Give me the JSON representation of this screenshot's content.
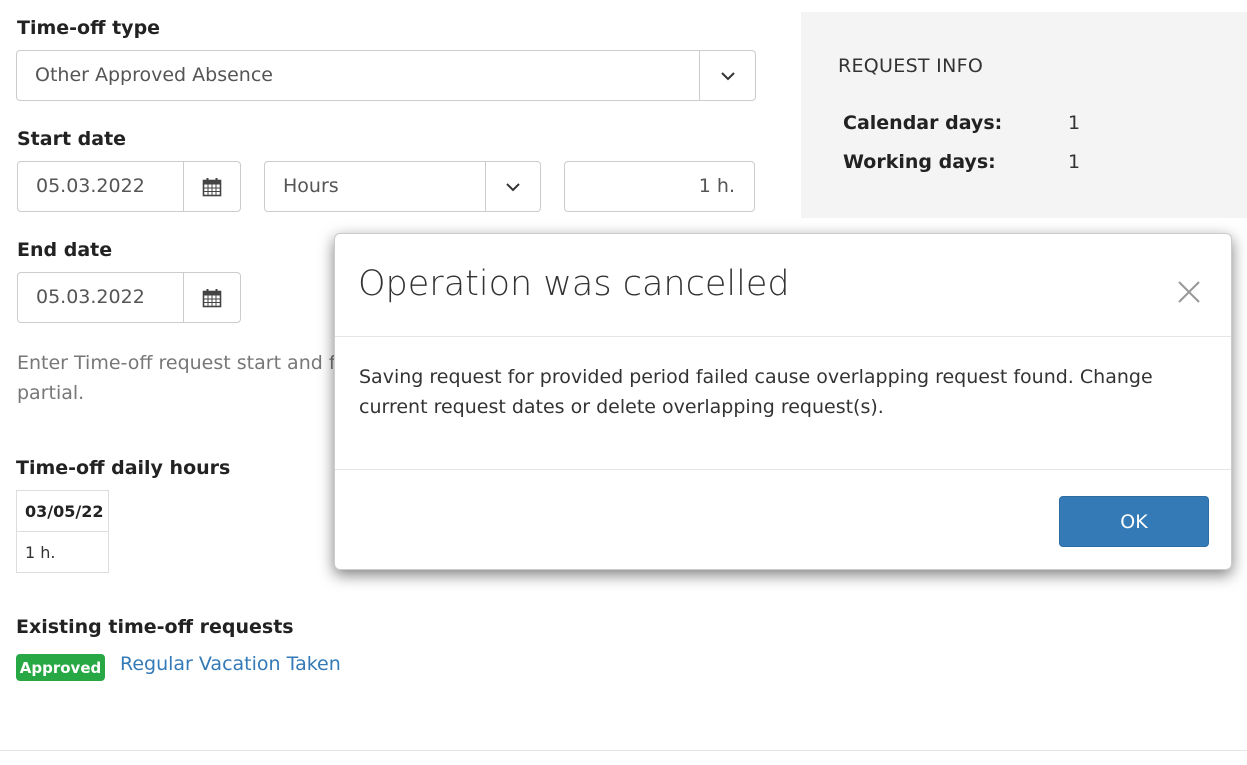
{
  "form": {
    "timeoff_type_label": "Time-off type",
    "timeoff_type_value": "Other Approved Absence",
    "start_date_label": "Start date",
    "start_date_value": "05.03.2022",
    "unit_value": "Hours",
    "amount_value": "1 h.",
    "end_date_label": "End date",
    "end_date_value": "05.03.2022",
    "hint_text": "Enter Time-off request start and fi partial."
  },
  "daily_hours": {
    "label": "Time-off daily hours",
    "date": "03/05/22",
    "hours": "1 h."
  },
  "existing": {
    "label": "Existing time-off requests",
    "badge": "Approved",
    "badge_color": "#28a745",
    "link_text": "Regular Vacation Taken"
  },
  "request_info": {
    "title": "REQUEST INFO",
    "calendar_days_label": "Calendar days:",
    "calendar_days_value": "1",
    "working_days_label": "Working days:",
    "working_days_value": "1"
  },
  "modal": {
    "title": "Operation was cancelled",
    "body": "Saving request for provided period failed cause overlapping request found. Change current request dates or delete overlapping request(s).",
    "ok_label": "OK",
    "ok_color": "#337ab7"
  },
  "icons": {
    "dropdown": "chevron-down-icon",
    "calendar": "calendar-icon",
    "close": "close-icon"
  }
}
